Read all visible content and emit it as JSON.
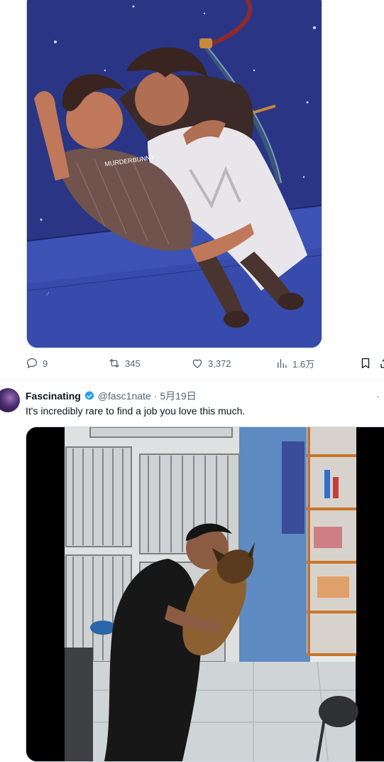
{
  "tweet1": {
    "media": {
      "icon": "illustration-image",
      "signature": "MURDERBUNNY"
    },
    "actions": {
      "replies": "9",
      "retweets": "345",
      "likes": "3,372",
      "views": "1.6万"
    }
  },
  "tweet2": {
    "author": {
      "name": "Fascinating",
      "handle": "@fasc1nate",
      "separator": "·",
      "date": "5月19日",
      "verified_color": "#1d9bf0"
    },
    "text": "It's incredibly rare to find a job you love this much.",
    "more": "·",
    "media": {
      "icon": "video-frame"
    }
  },
  "colors": {
    "accent": "#1d9bf0",
    "text_secondary": "#536471",
    "border": "#cfd9de"
  }
}
